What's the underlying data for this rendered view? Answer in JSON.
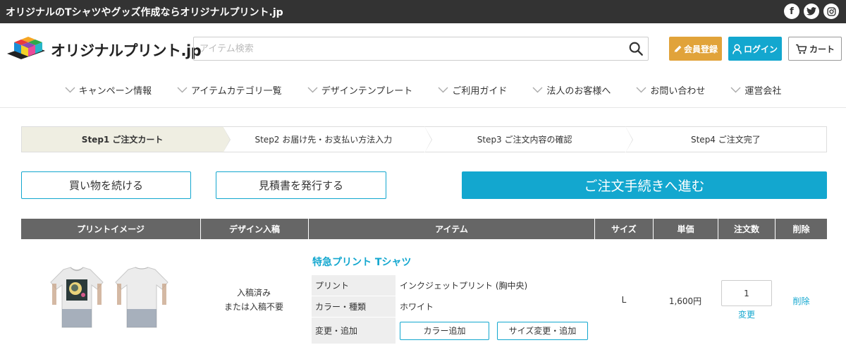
{
  "topbar": {
    "tagline": "オリジナルのTシャツやグッズ作成ならオリジナルプリント.jp",
    "social": [
      {
        "icon": "facebook-icon",
        "glyph": "f"
      },
      {
        "icon": "twitter-icon",
        "glyph": "t"
      },
      {
        "icon": "instagram-icon",
        "glyph": "◎"
      }
    ]
  },
  "header": {
    "logo_text": "オリジナルプリント.jp",
    "search_placeholder": "アイテム検索",
    "register_label": "会員登録",
    "login_label": "ログイン",
    "cart_label": "カート"
  },
  "nav": [
    "キャンペーン情報",
    "アイテムカテゴリ一覧",
    "デザインテンプレート",
    "ご利用ガイド",
    "法人のお客様へ",
    "お問い合わせ",
    "運営会社"
  ],
  "steps": [
    {
      "label": "Step1 ご注文カート",
      "active": true
    },
    {
      "label": "Step2 お届け先・お支払い方法入力",
      "active": false
    },
    {
      "label": "Step3 ご注文内容の確認",
      "active": false
    },
    {
      "label": "Step4 ご注文完了",
      "active": false
    }
  ],
  "actions": {
    "continue_label": "買い物を続ける",
    "estimate_label": "見積書を発行する",
    "checkout_label": "ご注文手続きへ進む"
  },
  "table": {
    "headers": [
      "プリントイメージ",
      "デザイン入稿",
      "アイテム",
      "サイズ",
      "単価",
      "注文数",
      "削除"
    ],
    "row": {
      "design_status_1": "入稿済み",
      "design_status_2": "または入稿不要",
      "item_name": "特急プリント Tシャツ",
      "specs": [
        {
          "label": "プリント",
          "value": "インクジェットプリント (胸中央)"
        },
        {
          "label": "カラー・種類",
          "value": "ホワイト"
        }
      ],
      "change_label": "変更・追加",
      "add_color_label": "カラー追加",
      "change_size_label": "サイズ変更・追加",
      "size": "L",
      "price": "1,600円",
      "quantity": "1",
      "qty_change_label": "変更",
      "delete_label": "削除"
    }
  },
  "colors": {
    "accent": "#13a7cf",
    "register": "#e1a33a",
    "topbar": "#333333",
    "table_header": "#666666"
  }
}
